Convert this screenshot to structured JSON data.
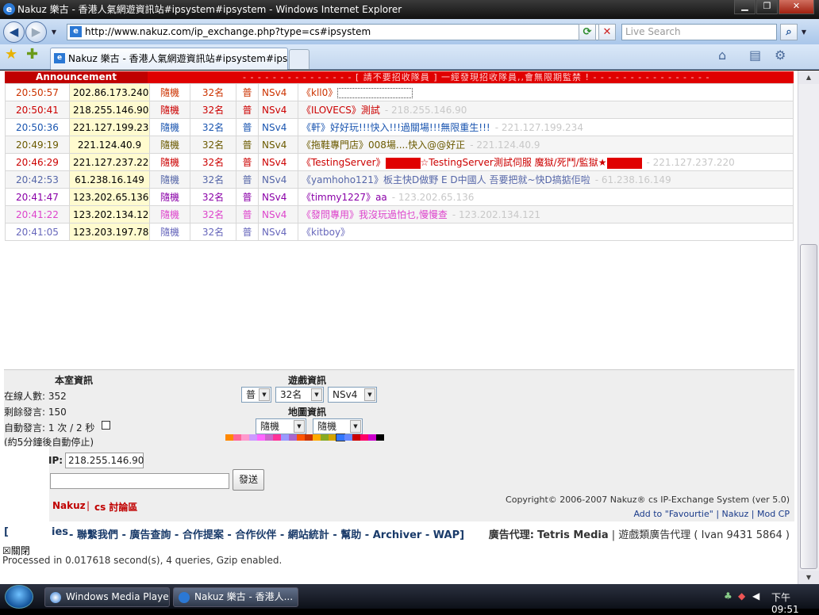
{
  "window": {
    "title": "Nakuz 樂古 - 香港人氣網遊資訊站#ipsystem#ipsystem - Windows Internet Explorer"
  },
  "browser": {
    "url": "http://www.nakuz.com/ip_exchange.php?type=cs#ipsystem",
    "search_placeholder": "Live Search",
    "tab_title": "Nakuz 樂古 - 香港人氣網遊資訊站#ipsystem#ipsys..."
  },
  "announcement": {
    "label": "Announcement",
    "message": "- - - - - - - - - - - - - - - [ 請不要招收隊員 ] 一經發現招收隊員,,會無限期監禁 ! - - - - - - - - - - - - - - - -"
  },
  "entries": [
    {
      "time": "20:50:57",
      "ip": "202.86.173.240",
      "map": "隨機",
      "players": "32名",
      "mode": "普",
      "ver": "NSv4",
      "server": "《kll0》",
      "msg": "",
      "ip2": "",
      "color": "#cc3300",
      "box": true,
      "redblocks": false
    },
    {
      "time": "20:50:41",
      "ip": "218.255.146.90",
      "map": "隨機",
      "players": "32名",
      "mode": "普",
      "ver": "NSv4",
      "server": "《ILOVECS》",
      "msg": "測試",
      "ip2": "- 218.255.146.90",
      "color": "#cc0000",
      "box": false,
      "redblocks": false
    },
    {
      "time": "20:50:36",
      "ip": "221.127.199.234",
      "map": "隨機",
      "players": "32名",
      "mode": "普",
      "ver": "NSv4",
      "server": "《軒》",
      "msg": "好好玩!!!快入!!!過關場!!!無限重生!!!",
      "ip2": "- 221.127.199.234",
      "color": "#1a55b0",
      "box": false,
      "redblocks": false
    },
    {
      "time": "20:49:19",
      "ip": "221.124.40.9",
      "map": "隨機",
      "players": "32名",
      "mode": "普",
      "ver": "NSv4",
      "server": "《拖鞋專門店》",
      "msg": "008場....快入@@好正",
      "ip2": "- 221.124.40.9",
      "color": "#6b5a00",
      "box": false,
      "redblocks": false
    },
    {
      "time": "20:46:29",
      "ip": "221.127.237.220",
      "map": "隨機",
      "players": "32名",
      "mode": "普",
      "ver": "NSv4",
      "server": "《TestingServer》",
      "msg": "☆TestingServer測試伺服 魔獄/死鬥/監獄★",
      "ip2": "- 221.127.237.220",
      "color": "#cc0000",
      "box": false,
      "redblocks": true
    },
    {
      "time": "20:42:53",
      "ip": "61.238.16.149",
      "map": "隨機",
      "players": "32名",
      "mode": "普",
      "ver": "NSv4",
      "server": "《yamhoho121》",
      "msg": "板主快D做野 E D中國人 吾要把就~快D搞掂佢啦",
      "ip2": "- 61.238.16.149",
      "color": "#5566a8",
      "box": false,
      "redblocks": false
    },
    {
      "time": "20:41:47",
      "ip": "123.202.65.136",
      "map": "隨機",
      "players": "32名",
      "mode": "普",
      "ver": "NSv4",
      "server": "《timmy1227》",
      "msg": "aa",
      "ip2": "- 123.202.65.136",
      "color": "#8a00a8",
      "box": false,
      "redblocks": false
    },
    {
      "time": "20:41:22",
      "ip": "123.202.134.121",
      "map": "隨機",
      "players": "32名",
      "mode": "普",
      "ver": "NSv4",
      "server": "《發問專用》",
      "msg": "我沒玩過怕乜,慢慢查",
      "ip2": "- 123.202.134.121",
      "color": "#dd44cc",
      "box": false,
      "redblocks": false
    },
    {
      "time": "20:41:05",
      "ip": "123.203.197.78",
      "map": "隨機",
      "players": "32名",
      "mode": "普",
      "ver": "NSv4",
      "server": "《kitboy》",
      "msg": "",
      "ip2": "",
      "color": "#6666bb",
      "box": false,
      "redblocks": false
    }
  ],
  "room": {
    "title": "本室資訊",
    "online": "在線人數: 352",
    "remaining": "剩餘發言: 150",
    "auto": "自動發言: 1 次 / 2 秒",
    "auto_note": "(約5分鐘後自動停止)"
  },
  "game": {
    "title": "遊戲資訊",
    "mode_value": "普",
    "players_value": "32名",
    "version_value": "NSv4",
    "map_title": "地圖資訊",
    "map_value1": "隨機",
    "map_value2": "隨機"
  },
  "swatch_colors": [
    "#ff8800",
    "#ff6699",
    "#ff99cc",
    "#cc99ff",
    "#ff66ff",
    "#cc66cc",
    "#ff3399",
    "#9999ff",
    "#aa66cc",
    "#ff5500",
    "#cc3300",
    "#ffaa00",
    "#88aa22",
    "#d4a400",
    "#3377ff",
    "#6688ff",
    "#cc0000",
    "#ff0066",
    "#cc00cc",
    "#000000"
  ],
  "form": {
    "ip_label": "IP:",
    "ip_value": "218.255.146.90",
    "send_label": "發送",
    "nakuz": "Nakuz",
    "sep": "|",
    "forum": "cs 討論區"
  },
  "copyright": {
    "line1": "Copyright© 2006-2007  Nakuz® cs IP-Exchange System (ver 5.0)",
    "add_fav": "Add to \"Favourtie\"",
    "nakuz": "Nakuz",
    "mod": "Mod CP"
  },
  "links": {
    "partial": "ies",
    "items": [
      "聯繫我們",
      "廣告查詢",
      "合作提案",
      "合作伙伴",
      "網站統計",
      "幫助",
      "Archiver",
      "WAP"
    ],
    "ad_label": "廣告代理:",
    "ad_name": "Tetris Media",
    "ad_rest": "| 遊戲類廣告代理 ( Ivan 9431 5864 )"
  },
  "close_label": "關閉",
  "processed": "Processed in 0.017618 second(s), 4 queries, Gzip enabled.",
  "taskbar": {
    "item1": "Windows Media Player",
    "item2": "Nakuz 樂古 - 香港人...",
    "clock": "下午 09:51"
  }
}
